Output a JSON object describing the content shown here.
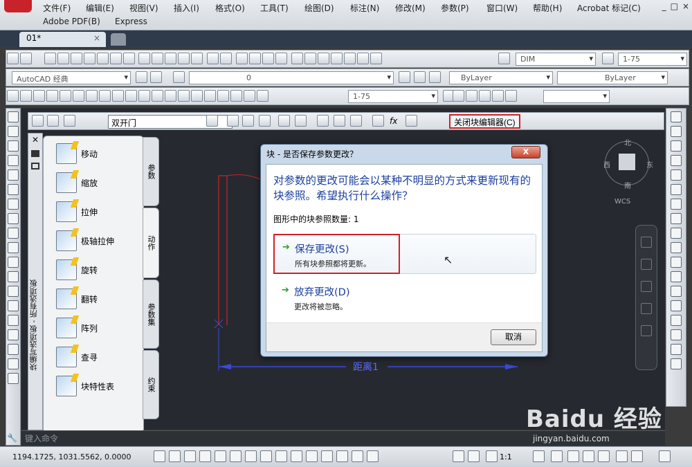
{
  "menubar": {
    "items": [
      "文件(F)",
      "编辑(E)",
      "视图(V)",
      "插入(I)",
      "格式(O)",
      "工具(T)",
      "绘图(D)",
      "标注(N)",
      "修改(M)",
      "参数(P)",
      "窗口(W)",
      "帮助(H)",
      "Acrobat 标记(C)"
    ],
    "row2": [
      "Adobe PDF(B)",
      "Express"
    ],
    "window_controls": [
      "_",
      "□",
      "×"
    ]
  },
  "document": {
    "tab_label": "01*",
    "tab_close": "×"
  },
  "toolbars": {
    "dimstyle": "DIM",
    "scale": "1-75",
    "workspace": "AutoCAD 经典",
    "layer": "0",
    "color": "ByLayer",
    "linetype": "ByLayer",
    "dim_scale": "1-75"
  },
  "block_editor": {
    "block_name": "双开门",
    "close_button": "关闭块编辑器(C)",
    "fx_icon": "fx"
  },
  "palette": {
    "title": "块编写选项板 - 所有选项板",
    "items": [
      "移动",
      "缩放",
      "拉伸",
      "极轴拉伸",
      "旋转",
      "翻转",
      "阵列",
      "查寻",
      "块特性表"
    ],
    "tabs": [
      "参数",
      "动作",
      "参数集",
      "约束"
    ]
  },
  "drawing": {
    "dimension_label": "距离1"
  },
  "viewcube": {
    "north": "北",
    "west": "西",
    "east": "东",
    "south": "南",
    "wcs": "WCS"
  },
  "dialog": {
    "title": "块 - 是否保存参数更改？",
    "close": "X",
    "main_text": "对参数的更改可能会以某种不明显的方式来更新现有的块参照。希望执行什么操作？",
    "count_text": "图形中的块参照数量: 1",
    "save_label": "保存更改(S)",
    "save_sub": "所有块参照都将更新。",
    "discard_label": "放弃更改(D)",
    "discard_sub": "更改将被忽略。",
    "cancel": "取消"
  },
  "command_line": {
    "placeholder": "键入命令"
  },
  "status": {
    "coords": "1194.1725, 1031.5562, 0.0000",
    "annotation_scale": "1:1"
  },
  "watermark": {
    "brand": "Baidu 经验",
    "url": "jingyan.baidu.com"
  }
}
